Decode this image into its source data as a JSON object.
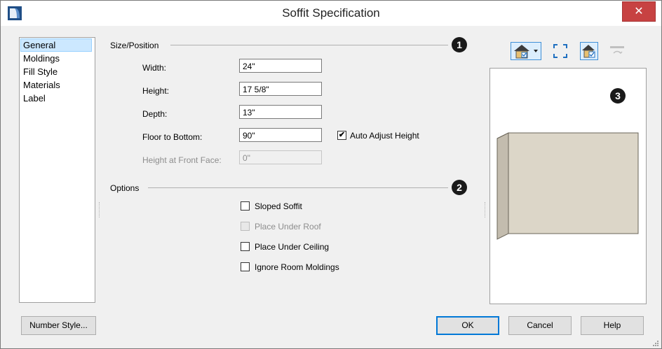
{
  "window": {
    "title": "Soffit Specification",
    "close_glyph": "✕"
  },
  "sidebar": {
    "items": [
      {
        "label": "General"
      },
      {
        "label": "Moldings"
      },
      {
        "label": "Fill Style"
      },
      {
        "label": "Materials"
      },
      {
        "label": "Label"
      }
    ],
    "selected": "General"
  },
  "size_position": {
    "title": "Size/Position",
    "callout": "1",
    "width": {
      "label": "Width:",
      "value": "24\""
    },
    "height": {
      "label": "Height:",
      "value": "17 5/8\""
    },
    "depth": {
      "label": "Depth:",
      "value": "13\""
    },
    "floor_to_bottom": {
      "label": "Floor to Bottom:",
      "value": "90\""
    },
    "auto_adjust": {
      "label": "Auto Adjust Height",
      "checked": true
    },
    "height_front_face": {
      "label": "Height at Front Face:",
      "value": "0\"",
      "disabled": true
    }
  },
  "options": {
    "title": "Options",
    "callout": "2",
    "sloped_soffit": {
      "label": "Sloped Soffit",
      "checked": false
    },
    "place_under_roof": {
      "label": "Place Under Roof",
      "checked": false,
      "disabled": true
    },
    "place_under_ceiling": {
      "label": "Place Under Ceiling",
      "checked": false
    },
    "ignore_room_moldings": {
      "label": "Ignore Room Moldings",
      "checked": false
    }
  },
  "preview": {
    "callout": "3",
    "toolbar": [
      "house-view-dropdown-icon",
      "fill-window-icon",
      "show-materials-icon",
      "reset-view-icon"
    ],
    "soffit_color": "#dcd6c8"
  },
  "footer": {
    "number_style": "Number Style...",
    "ok": "OK",
    "cancel": "Cancel",
    "help": "Help"
  },
  "colors": {
    "close_button": "#c74242",
    "accent": "#0078d7",
    "selection": "#cce8ff"
  }
}
